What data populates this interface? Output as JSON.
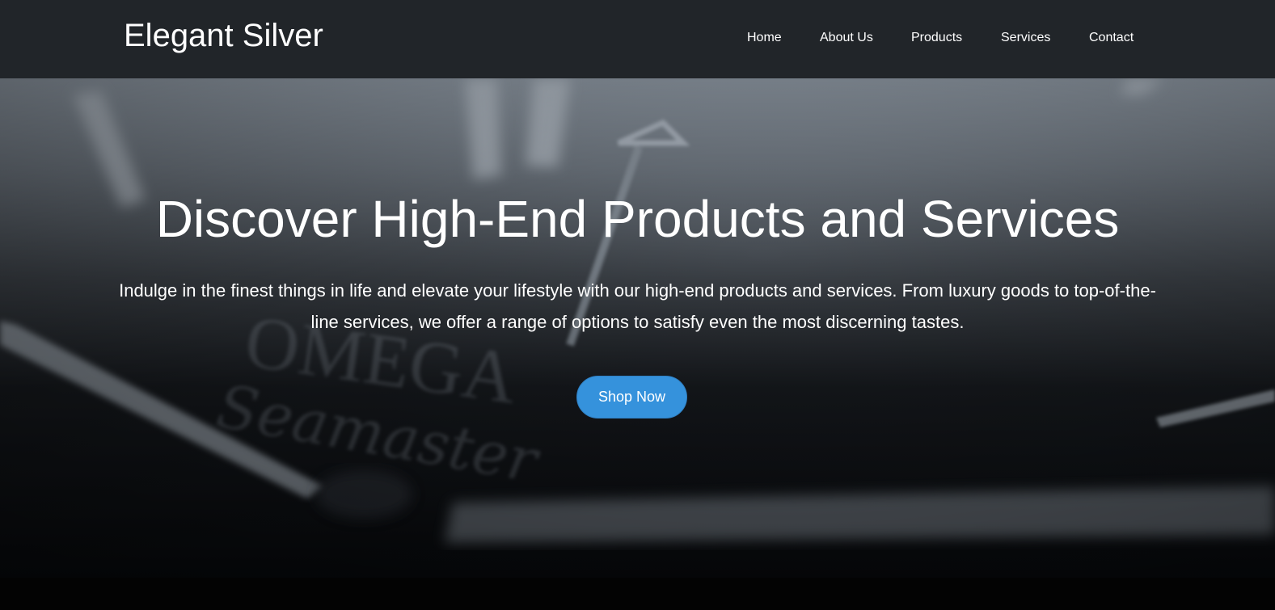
{
  "brand": {
    "name": "Elegant Silver"
  },
  "nav": {
    "items": [
      {
        "label": "Home"
      },
      {
        "label": "About Us"
      },
      {
        "label": "Products"
      },
      {
        "label": "Services"
      },
      {
        "label": "Contact"
      }
    ]
  },
  "hero": {
    "title": "Discover High-End Products and Services",
    "description": "Indulge in the finest things in life and elevate your lifestyle with our high-end products and services. From luxury goods to top-of-the-line services, we offer a range of options to satisfy even the most discerning tastes.",
    "cta_label": "Shop Now",
    "background_watermark": [
      "OMEGA",
      "Seamaster"
    ]
  },
  "colors": {
    "navbar_bg": "#212529",
    "cta_bg": "#3592dc",
    "text": "#ffffff"
  }
}
